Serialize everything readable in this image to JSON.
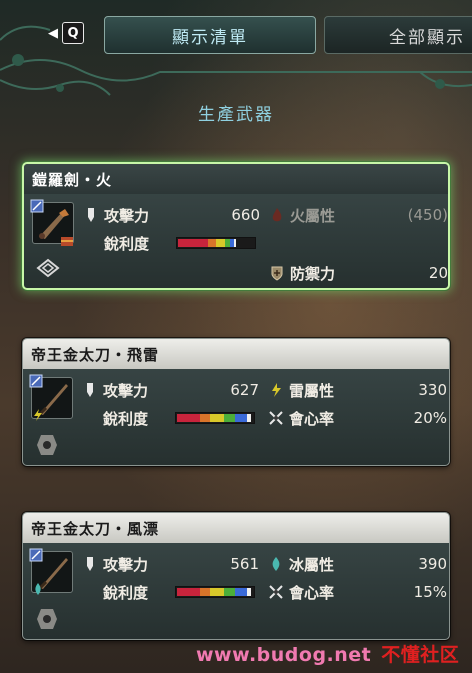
{
  "header": {
    "nav_key": "Q",
    "tabs": [
      {
        "label": "顯示清單",
        "active": true
      },
      {
        "label": "全部顯示",
        "active": false
      }
    ],
    "section_title": "生產武器"
  },
  "weapons": [
    {
      "name": "鎧羅劍・火",
      "selected": true,
      "attack_label": "攻擊力",
      "attack": "660",
      "sharpness_label": "銳利度",
      "sharpness": {
        "red": 0.4,
        "orange": 0.1,
        "yellow": 0.12,
        "green": 0.06,
        "blue": 0.06,
        "white": 0.02,
        "empty": 0.24
      },
      "element_label": "火屬性",
      "element_value": "(450)",
      "element_active": false,
      "element_icon": "fire-icon",
      "extra_label": "防禦力",
      "extra_value": "20",
      "extra_icon": "shield-icon",
      "slot_icon": "decoration-slot-icon"
    },
    {
      "name": "帝王金太刀・飛雷",
      "selected": false,
      "attack_label": "攻擊力",
      "attack": "627",
      "sharpness_label": "銳利度",
      "sharpness": {
        "red": 0.3,
        "orange": 0.14,
        "yellow": 0.18,
        "green": 0.14,
        "blue": 0.16,
        "white": 0.06,
        "empty": 0.02
      },
      "element_label": "雷屬性",
      "element_value": "330",
      "element_active": true,
      "element_icon": "thunder-icon",
      "extra_label": "會心率",
      "extra_value": "20%",
      "extra_icon": "affinity-icon",
      "slot_icon": "decoration-slot-icon"
    },
    {
      "name": "帝王金太刀・風漂",
      "selected": false,
      "attack_label": "攻擊力",
      "attack": "561",
      "sharpness_label": "銳利度",
      "sharpness": {
        "red": 0.3,
        "orange": 0.14,
        "yellow": 0.18,
        "green": 0.14,
        "blue": 0.16,
        "white": 0.06,
        "empty": 0.02
      },
      "element_label": "冰屬性",
      "element_value": "390",
      "element_active": true,
      "element_icon": "ice-icon",
      "extra_label": "會心率",
      "extra_value": "15%",
      "extra_icon": "affinity-icon",
      "slot_icon": "decoration-slot-icon"
    }
  ],
  "watermark": {
    "url": "www.budog.net",
    "text": "不懂社区"
  },
  "colors": {
    "sharp_red": "#c8243c",
    "sharp_orange": "#d8742a",
    "sharp_yellow": "#d8c82a",
    "sharp_green": "#4cae3a",
    "sharp_blue": "#3a6ad8",
    "sharp_white": "#f0f0f0",
    "selected_glow": "#c8f7a8"
  }
}
